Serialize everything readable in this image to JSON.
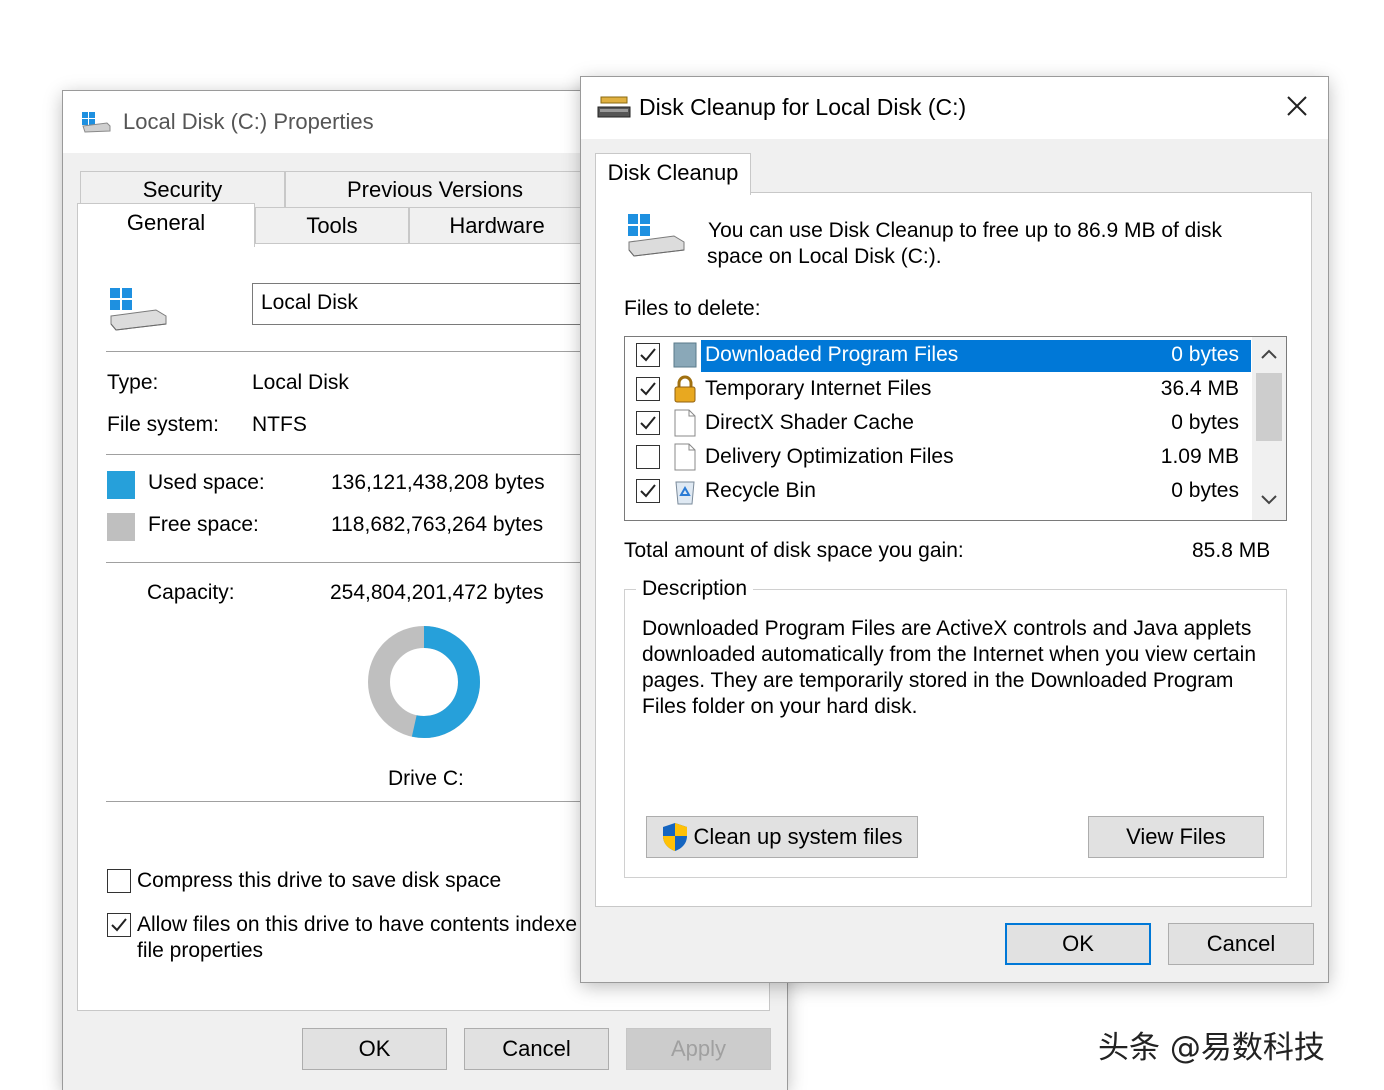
{
  "props": {
    "title": "Local Disk (C:) Properties",
    "tabs_top": [
      "Security",
      "Previous Versions"
    ],
    "tabs_bottom": [
      "General",
      "Tools",
      "Hardware"
    ],
    "name_value": "Local Disk",
    "type_label": "Type:",
    "type_value": "Local Disk",
    "fs_label": "File system:",
    "fs_value": "NTFS",
    "used_label": "Used space:",
    "used_value": "136,121,438,208 bytes",
    "free_label": "Free space:",
    "free_value": "118,682,763,264 bytes",
    "capacity_label": "Capacity:",
    "capacity_value": "254,804,201,472 bytes",
    "drive_label": "Drive C:",
    "used_fraction": 0.534,
    "used_color": "#26a0da",
    "free_color": "#bfbfbf",
    "compress_label": "Compress this drive to save disk space",
    "index_label_1": "Allow files on this drive to have contents indexe",
    "index_label_2": "file properties",
    "ok": "OK",
    "cancel": "Cancel",
    "apply": "Apply"
  },
  "cleanup": {
    "title": "Disk Cleanup for Local Disk (C:)",
    "tab": "Disk Cleanup",
    "intro_line1": "You can use Disk Cleanup to free up to 86.9 MB of disk",
    "intro_line2": "space on Local Disk (C:).",
    "files_label": "Files to delete:",
    "files": [
      {
        "name": "Downloaded Program Files",
        "size": "0 bytes",
        "checked": true,
        "icon": "folder-icon"
      },
      {
        "name": "Temporary Internet Files",
        "size": "36.4 MB",
        "checked": true,
        "icon": "lock-icon"
      },
      {
        "name": "DirectX Shader Cache",
        "size": "0 bytes",
        "checked": true,
        "icon": "file-icon"
      },
      {
        "name": "Delivery Optimization Files",
        "size": "1.09 MB",
        "checked": false,
        "icon": "file-icon"
      },
      {
        "name": "Recycle Bin",
        "size": "0 bytes",
        "checked": true,
        "icon": "recycle-bin-icon"
      }
    ],
    "total_label": "Total amount of disk space you gain:",
    "total_value": "85.8 MB",
    "desc_label": "Description",
    "desc_line1": "Downloaded Program Files are ActiveX controls and Java applets",
    "desc_line2": "downloaded automatically from the Internet when you view certain",
    "desc_line3": "pages. They are temporarily stored in the Downloaded Program",
    "desc_line4": "Files folder on your hard disk.",
    "cleanup_system": "Clean up system files",
    "view_files": "View Files",
    "ok": "OK",
    "cancel": "Cancel",
    "accent": "#0078d7"
  },
  "watermark": "头条 @易数科技"
}
